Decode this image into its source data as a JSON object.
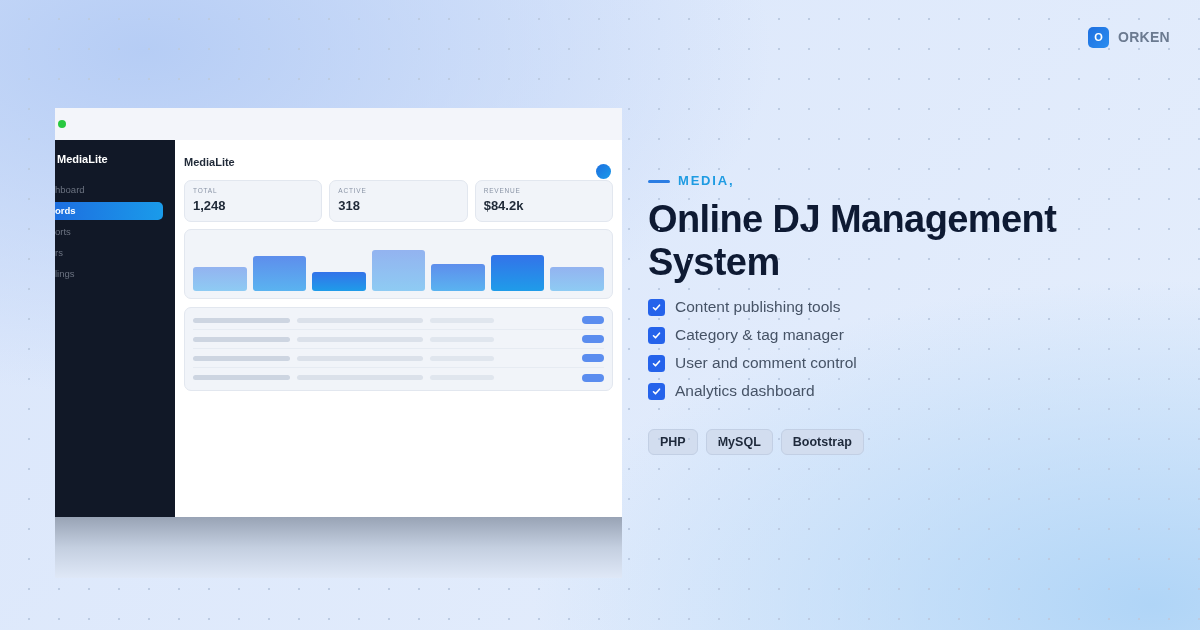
{
  "brand": {
    "initial": "O",
    "name": "ORKEN"
  },
  "mockup": {
    "sidebar": {
      "title": "MediaLite",
      "items": [
        {
          "label": "hboard",
          "selected": false
        },
        {
          "label": "ords",
          "selected": true
        },
        {
          "label": "orts",
          "selected": false
        },
        {
          "label": "rs",
          "selected": false
        },
        {
          "label": "lings",
          "selected": false
        }
      ]
    },
    "header": {
      "title": "MediaLite"
    },
    "stats": [
      {
        "label": "TOTAL",
        "value": "1,248"
      },
      {
        "label": "ACTIVE",
        "value": "318"
      },
      {
        "label": "REVENUE",
        "value": "$84.2k"
      }
    ]
  },
  "hero": {
    "eyebrow": "MEDIA,",
    "title": "Online DJ Management System",
    "features": [
      "Content publishing tools",
      "Category & tag manager",
      "User and comment control",
      "Analytics dashboard"
    ],
    "tags": [
      "PHP",
      "MySQL",
      "Bootstrap"
    ]
  }
}
